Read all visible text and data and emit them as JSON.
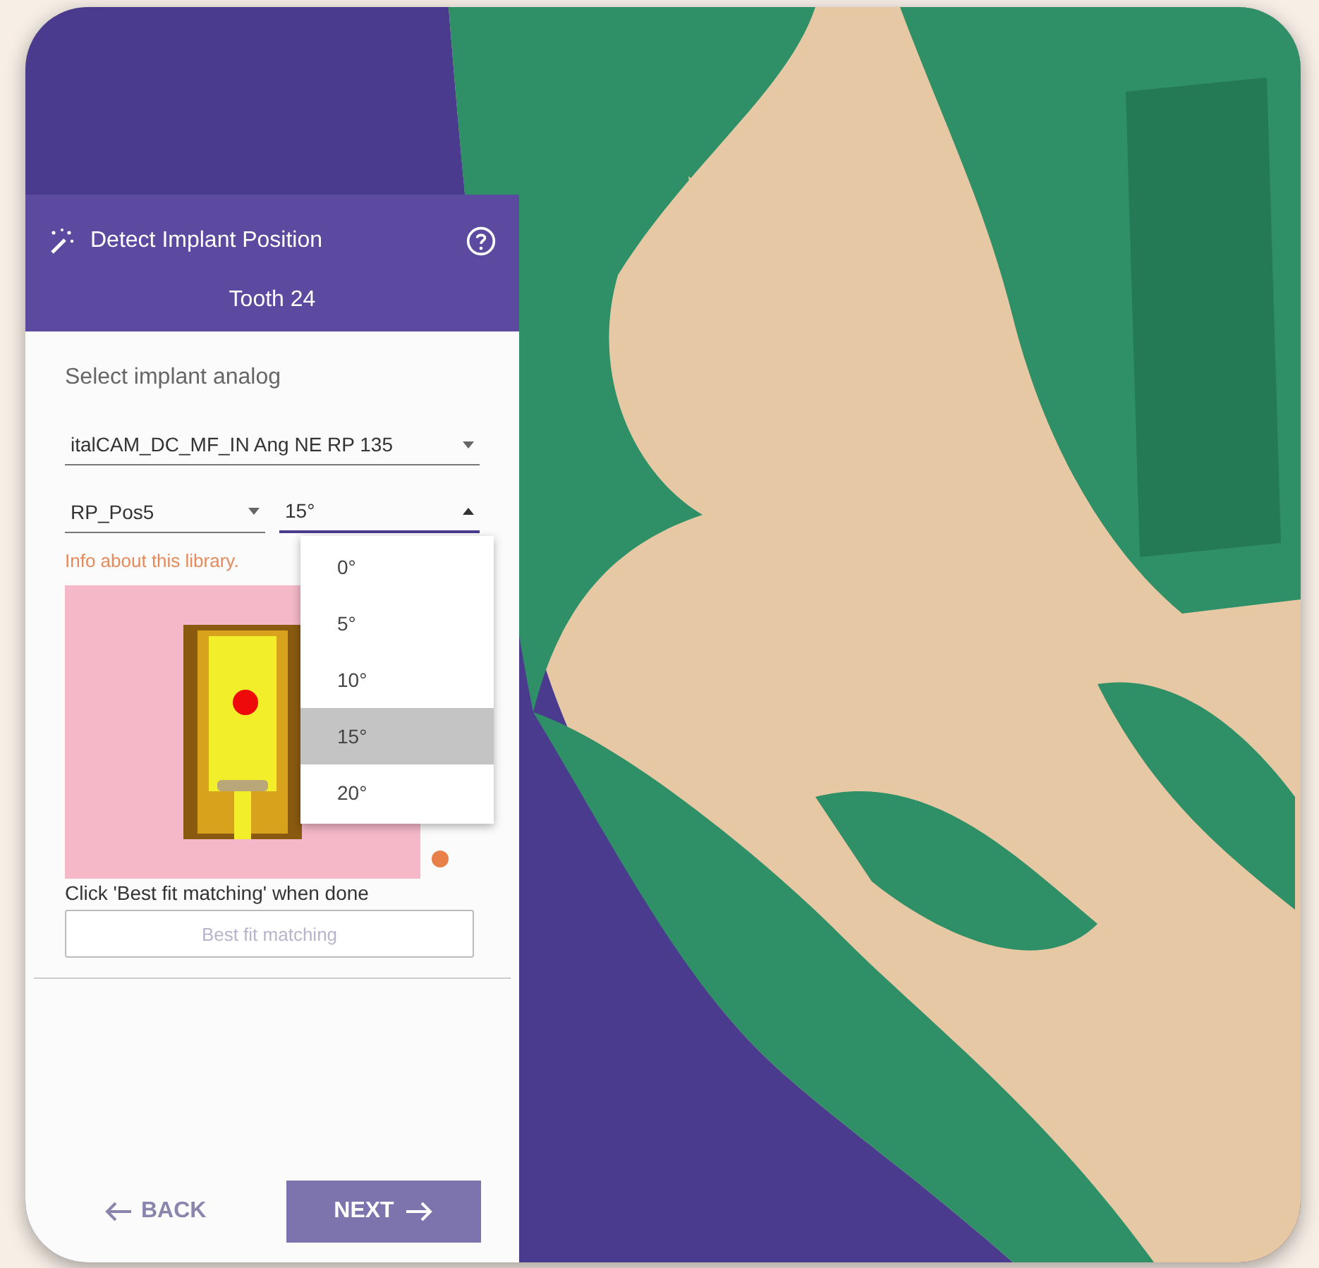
{
  "panel": {
    "title": "Detect Implant Position",
    "subtitle": "Tooth 24",
    "section_label": "Select implant analog",
    "library_select": {
      "value": "italCAM_DC_MF_IN Ang NE RP 135"
    },
    "position_select": {
      "value": "RP_Pos5"
    },
    "angle_select": {
      "value": "15°",
      "expanded": true,
      "options": [
        {
          "label": "0°",
          "selected": false
        },
        {
          "label": "5°",
          "selected": false
        },
        {
          "label": "10°",
          "selected": false
        },
        {
          "label": "15°",
          "selected": true
        },
        {
          "label": "20°",
          "selected": false
        }
      ]
    },
    "info_link": "Info about this library.",
    "hint": "Click 'Best fit matching' when done",
    "best_fit_button": {
      "label": "Best fit matching",
      "disabled": true
    },
    "back_button": {
      "label": "BACK"
    },
    "next_button": {
      "label": "NEXT"
    }
  }
}
